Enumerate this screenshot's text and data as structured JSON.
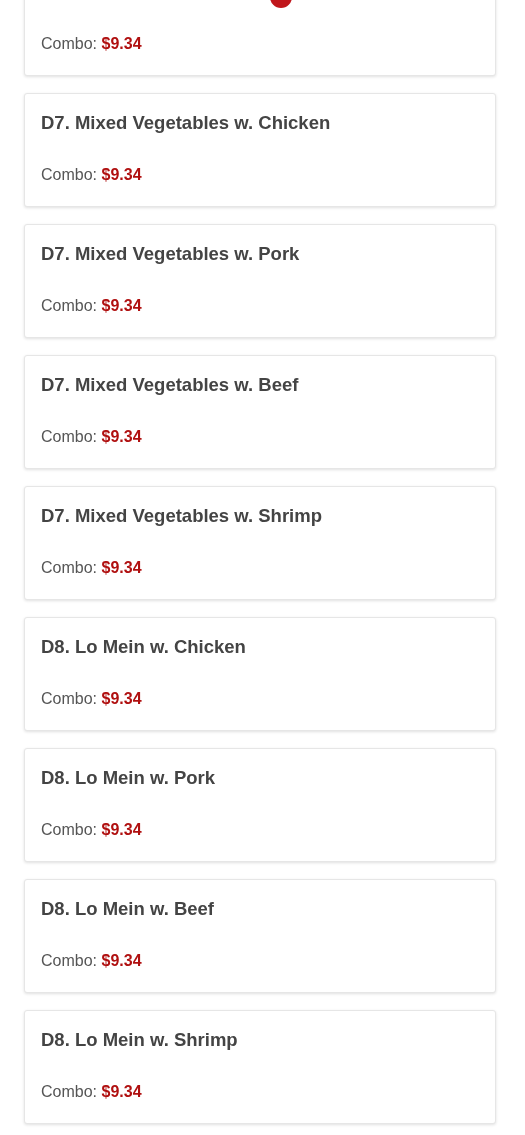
{
  "items": [
    {
      "hot": true,
      "price_label": "Combo:",
      "price": "$9.34"
    },
    {
      "name": "D7. Mixed Vegetables w. Chicken",
      "hot": false,
      "price_label": "Combo:",
      "price": "$9.34"
    },
    {
      "name": "D7. Mixed Vegetables w. Pork",
      "hot": false,
      "price_label": "Combo:",
      "price": "$9.34"
    },
    {
      "name": "D7. Mixed Vegetables w. Beef",
      "hot": false,
      "price_label": "Combo:",
      "price": "$9.34"
    },
    {
      "name": "D7. Mixed Vegetables w. Shrimp",
      "hot": false,
      "price_label": "Combo:",
      "price": "$9.34"
    },
    {
      "name": "D8. Lo Mein w. Chicken",
      "hot": false,
      "price_label": "Combo:",
      "price": "$9.34"
    },
    {
      "name": "D8. Lo Mein w. Pork",
      "hot": false,
      "price_label": "Combo:",
      "price": "$9.34"
    },
    {
      "name": "D8. Lo Mein w. Beef",
      "hot": false,
      "price_label": "Combo:",
      "price": "$9.34"
    },
    {
      "name": "D8. Lo Mein w. Shrimp",
      "hot": false,
      "price_label": "Combo:",
      "price": "$9.34"
    }
  ]
}
